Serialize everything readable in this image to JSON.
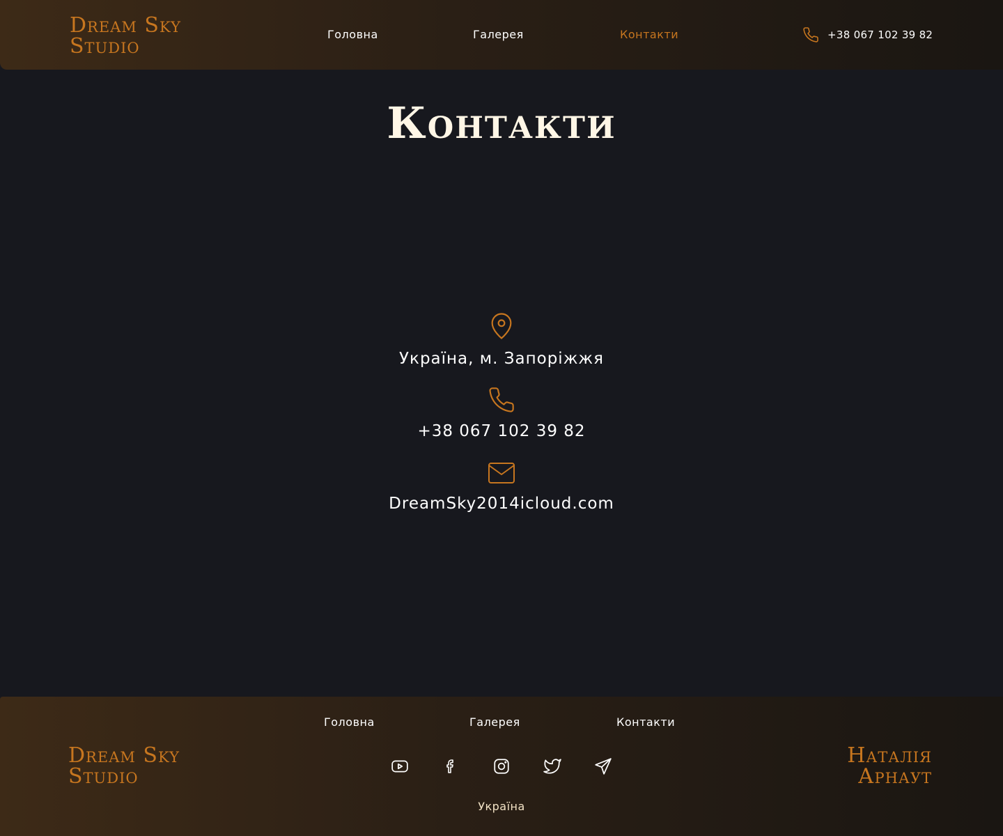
{
  "header": {
    "logo_line1": "Dream Sky",
    "logo_line2": "Studio",
    "nav": [
      "Головна",
      "Галерея",
      "Контакти"
    ],
    "active_nav": "Контакти",
    "phone": "+38 067 102 39 82",
    "phone_icon": "phone-icon"
  },
  "page_title": "Контакти",
  "contacts": {
    "address_icon": "map-pin-icon",
    "address": "Україна, м. Запоріжжя",
    "phone_icon": "phone-icon",
    "phone": "+38 067 102 39 82",
    "email_icon": "mail-icon",
    "email": "DreamSky2014icloud.com"
  },
  "footer": {
    "logo_line1": "Dream Sky",
    "logo_line2": "Studio",
    "nav": [
      "Головна",
      "Галерея",
      "Контакти"
    ],
    "socials": [
      "youtube-icon",
      "facebook-icon",
      "instagram-icon",
      "twitter-icon",
      "telegram-icon"
    ],
    "country": "Україна",
    "author_line1": "Наталія",
    "author_line2": "Арнаут"
  },
  "colors": {
    "accent": "#c7761f",
    "background": "#17181e",
    "title": "#fff6e6",
    "text": "#ffffff"
  }
}
